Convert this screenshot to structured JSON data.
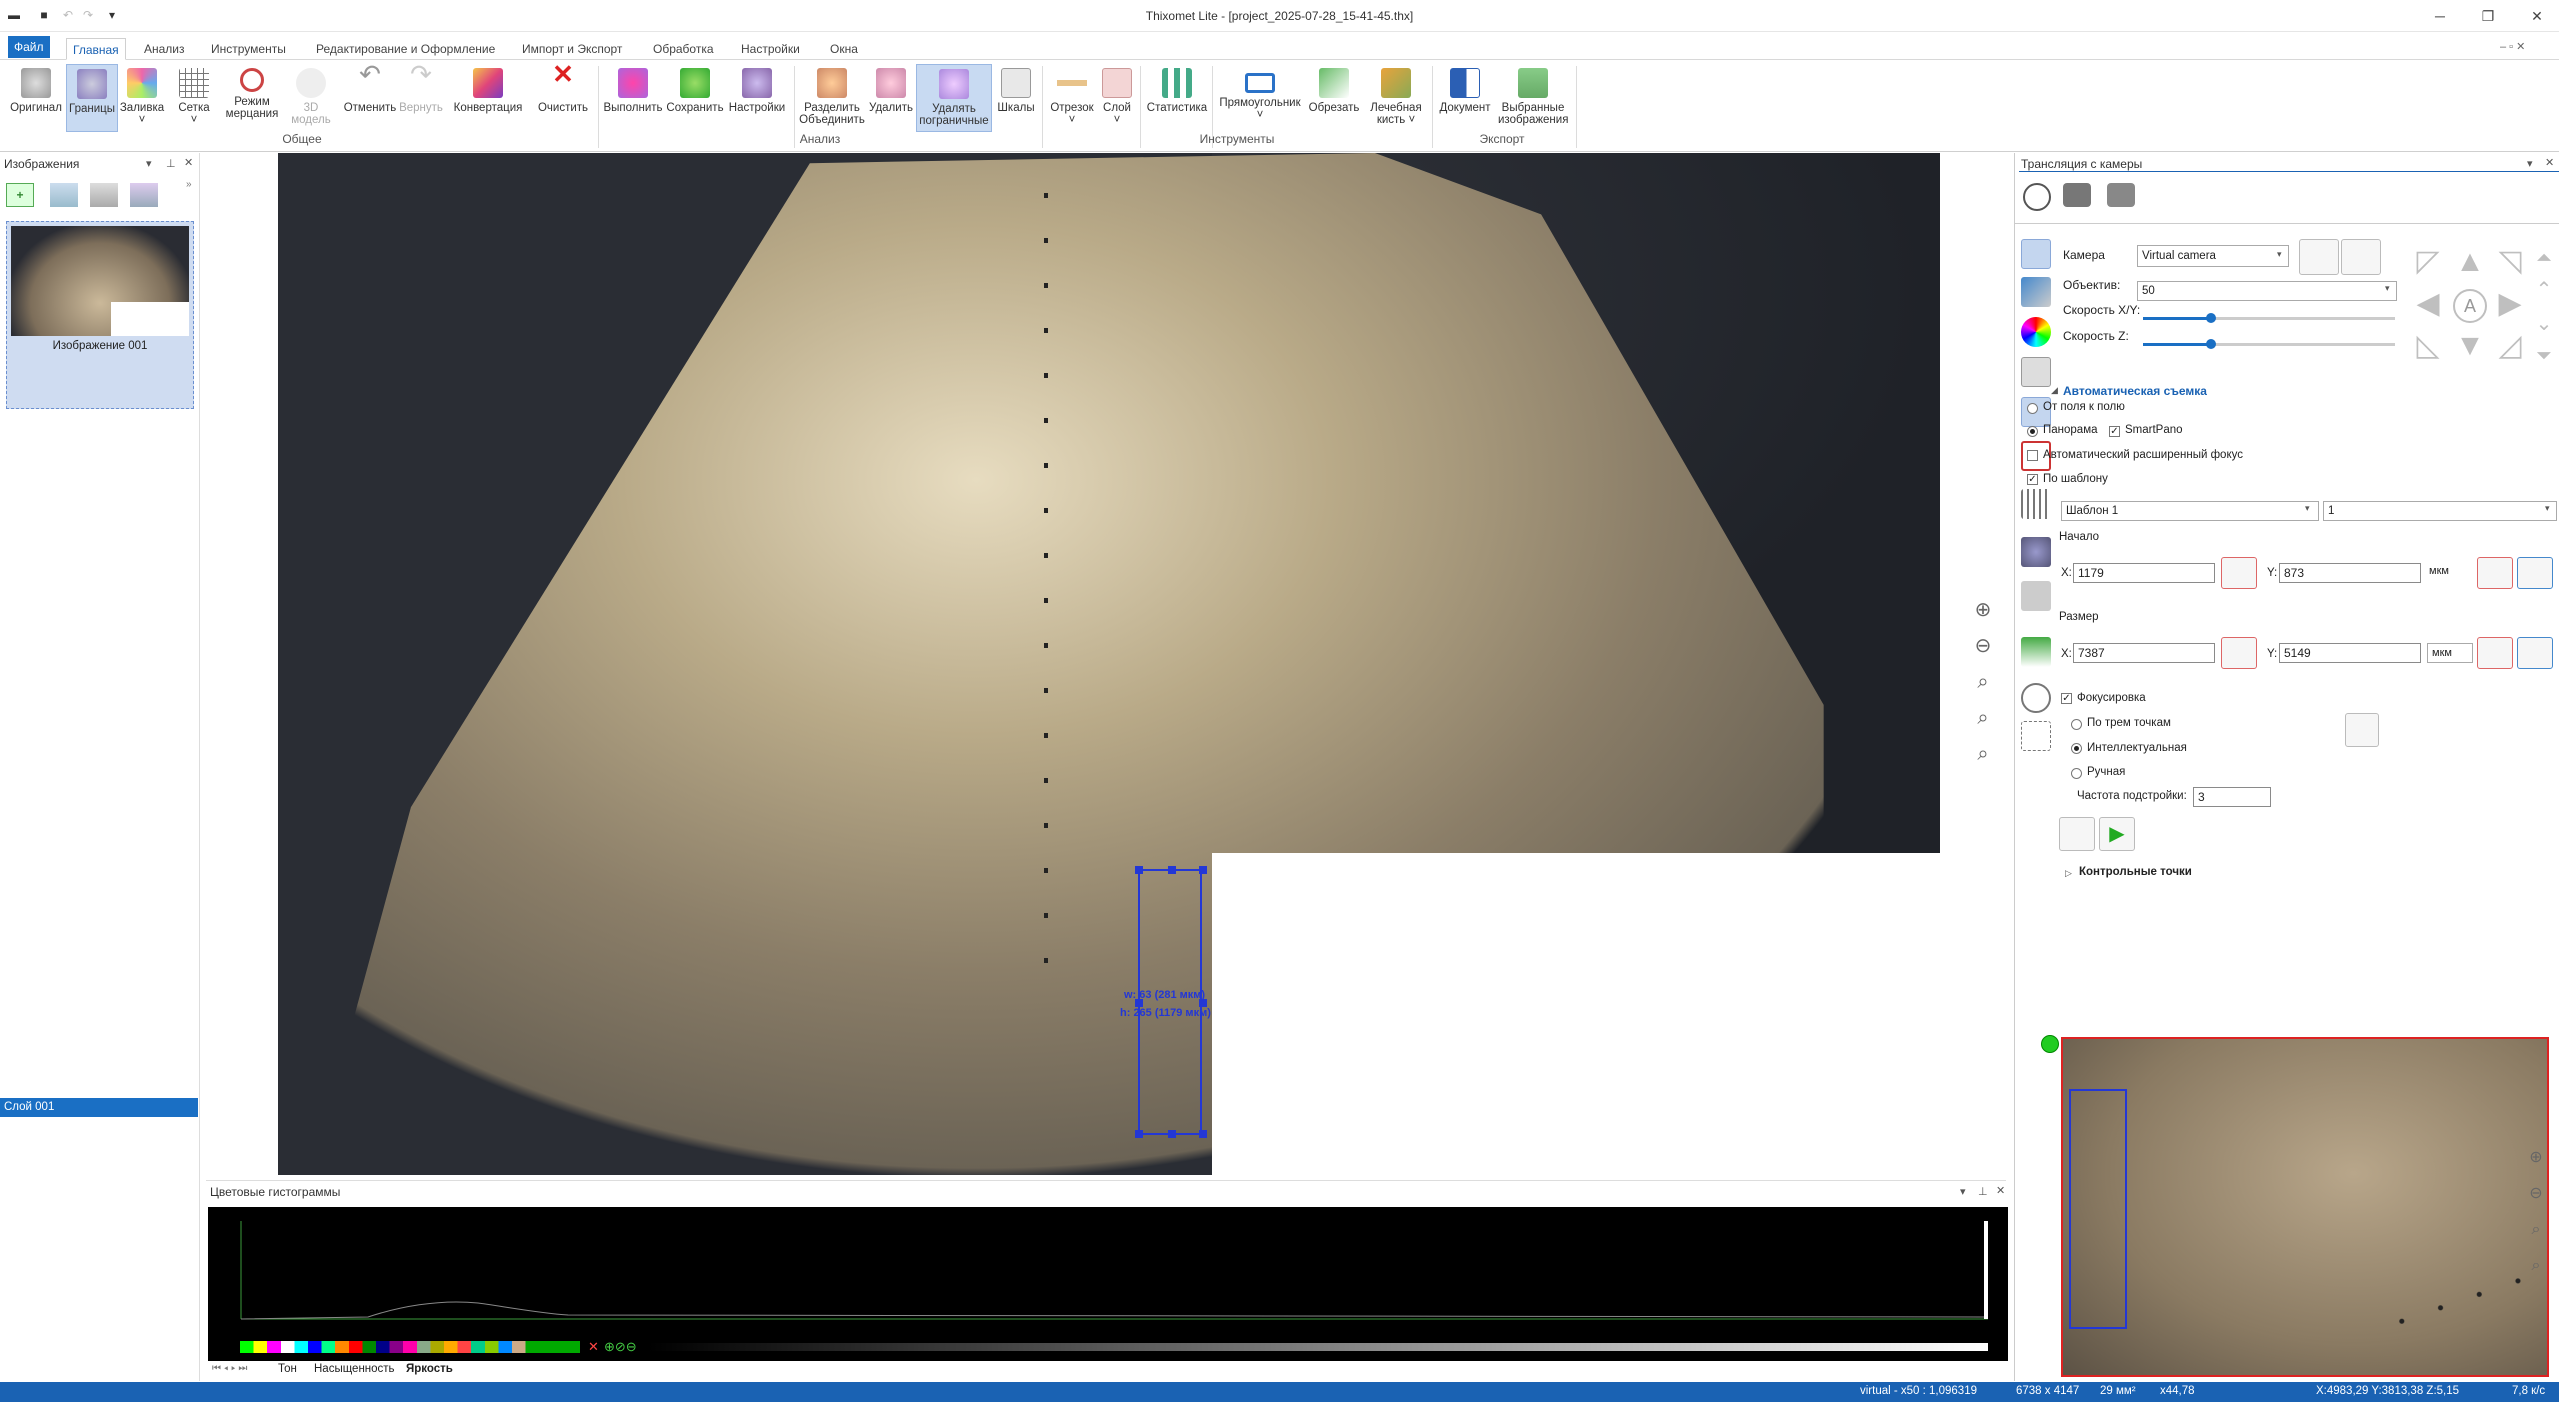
{
  "window": {
    "title": "Thixomet Lite - [project_2025-07-28_15-41-45.thx]"
  },
  "tabs": [
    "Файл",
    "Главная",
    "Анализ",
    "Инструменты",
    "Редактирование и Оформление",
    "Импорт и Экспорт",
    "Обработка",
    "Настройки",
    "Окна"
  ],
  "ribbon": {
    "buttons": [
      {
        "l1": "Оригинал",
        "l2": ""
      },
      {
        "l1": "Границы",
        "l2": ""
      },
      {
        "l1": "Заливка",
        "l2": "˅"
      },
      {
        "l1": "Сетка",
        "l2": "˅"
      },
      {
        "l1": "Режим",
        "l2": "мерцания"
      },
      {
        "l1": "3D",
        "l2": "модель"
      },
      {
        "l1": "Отменить",
        "l2": ""
      },
      {
        "l1": "Вернуть",
        "l2": ""
      },
      {
        "l1": "Конвертация",
        "l2": ""
      },
      {
        "l1": "Очистить",
        "l2": ""
      },
      {
        "l1": "Выполнить",
        "l2": ""
      },
      {
        "l1": "Сохранить",
        "l2": ""
      },
      {
        "l1": "Настройки",
        "l2": ""
      },
      {
        "l1": "Разделить",
        "l2": "Объединить"
      },
      {
        "l1": "Удалить",
        "l2": ""
      },
      {
        "l1": "Удалять",
        "l2": "пограничные"
      },
      {
        "l1": "Шкалы",
        "l2": ""
      },
      {
        "l1": "Отрезок",
        "l2": "˅"
      },
      {
        "l1": "Слой",
        "l2": "˅"
      },
      {
        "l1": "Статистика",
        "l2": ""
      },
      {
        "l1": "Прямоугольник",
        "l2": "˅"
      },
      {
        "l1": "Обрезать",
        "l2": ""
      },
      {
        "l1": "Лечебная",
        "l2": "кисть ˅"
      },
      {
        "l1": "Документ",
        "l2": ""
      },
      {
        "l1": "Выбранные",
        "l2": "изображения"
      }
    ],
    "groups": [
      "Общее",
      "Анализ",
      "Инструменты",
      "Экспорт"
    ]
  },
  "images_panel": {
    "title": "Изображения",
    "thumb_label": "Изображение 001",
    "layer": "Слой 001"
  },
  "measure": {
    "w": "w: 63 (281 мкм)",
    "h": "h: 265 (1179 мкм)"
  },
  "histogram": {
    "title": "Цветовые гистограммы",
    "tabs": [
      "Тон",
      "Насыщенность",
      "Яркость"
    ]
  },
  "camera": {
    "title": "Трансляция с камеры",
    "camera_label": "Камера",
    "camera_value": "Virtual camera",
    "objective_label": "Объектив:",
    "objective_value": "50",
    "speed_xy_label": "Скорость X/Y:",
    "speed_z_label": "Скорость Z:",
    "speed_xy": 0.9,
    "speed_z": 0.9,
    "auto_header": "Автоматическая съемка",
    "field_to_field": "От поля к полю",
    "panorama": "Панорама",
    "smartpano": "SmartPano",
    "auto_focus": "Автоматический расширенный фокус",
    "by_template": "По шаблону",
    "template_value": "Шаблон 1",
    "template_num": "1",
    "start_label": "Начало",
    "x_label": "X:",
    "y_label": "Y:",
    "start_x": "1179",
    "start_y": "873",
    "unit": "мкм",
    "size_label": "Размер",
    "size_x": "7387",
    "size_y": "5149",
    "size_unit": "мкм",
    "focus_label": "Фокусировка",
    "three_points": "По трем точкам",
    "intelligent": "Интеллектуальная",
    "manual": "Ручная",
    "freq_label": "Частота подстройки:",
    "freq_value": "3",
    "control_points": "Контрольные точки"
  },
  "status": {
    "virtual": "virtual - x50 : 1,096319",
    "dims": "6738 x 4147",
    "area": "29 мм²",
    "zoom": "x44,78",
    "coords": "X:4983,29 Y:3813,38 Z:5,15",
    "fps": "7,8 к/с"
  }
}
